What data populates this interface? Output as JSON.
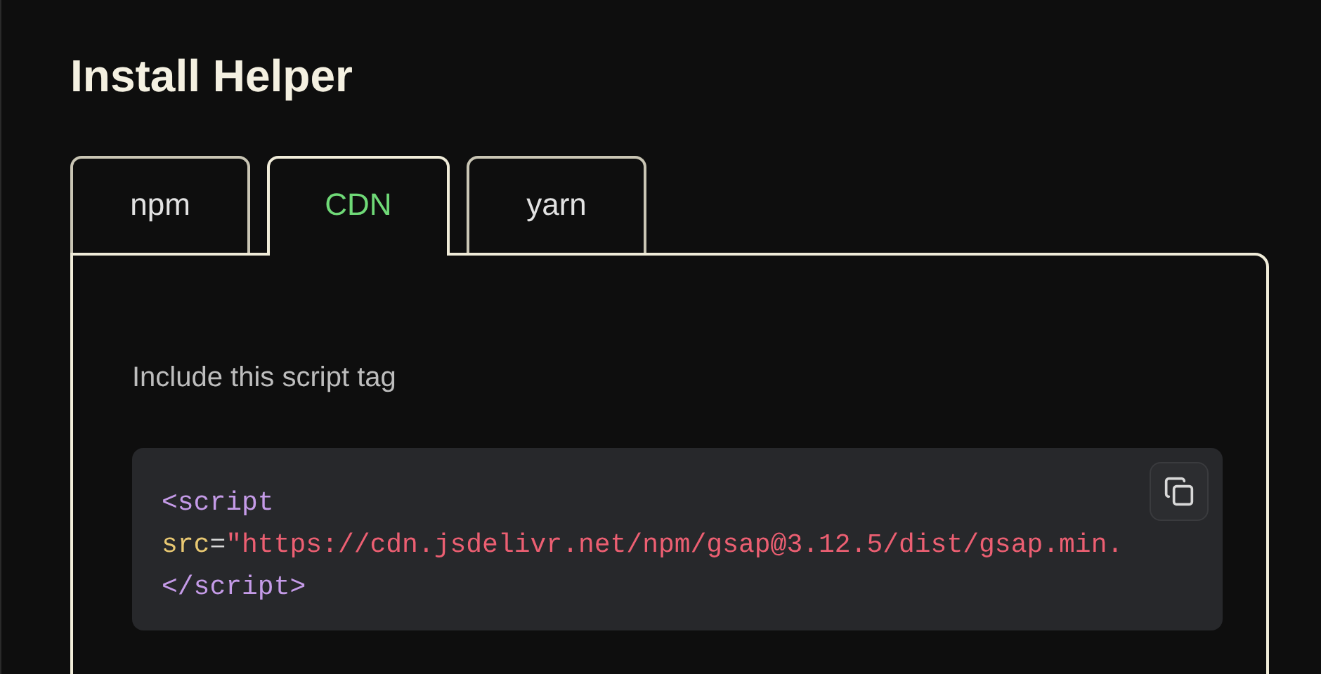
{
  "title": "Install Helper",
  "tabs": [
    {
      "label": "npm",
      "selected": false
    },
    {
      "label": "CDN",
      "selected": true
    },
    {
      "label": "yarn",
      "selected": false
    }
  ],
  "instruction": "Include this script tag",
  "code_lines": [
    [
      {
        "kind": "tag",
        "text": "<script"
      }
    ],
    [
      {
        "kind": "attr",
        "text": "src"
      },
      {
        "kind": "punct",
        "text": "="
      },
      {
        "kind": "string",
        "text": "\"https://cdn.jsdelivr.net/npm/gsap@3.12.5/dist/gsap.min."
      }
    ],
    [
      {
        "kind": "tag",
        "text": "</script>"
      }
    ]
  ]
}
